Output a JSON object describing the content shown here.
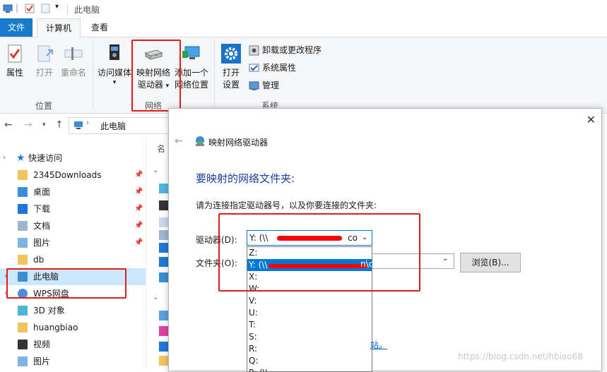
{
  "window": {
    "title": "此电脑"
  },
  "tabs": {
    "file": "文件",
    "computer": "计算机",
    "view": "查看"
  },
  "ribbon": {
    "location": {
      "properties": "属性",
      "open": "打开",
      "rename": "重命名",
      "group": "位置"
    },
    "network": {
      "media": "访问媒体",
      "map_drive_line1": "映射网络",
      "map_drive_line2": "驱动器",
      "add_location_line1": "添加一个",
      "add_location_line2": "网络位置",
      "group": "网络"
    },
    "system": {
      "open_settings_line1": "打开",
      "open_settings_line2": "设置",
      "uninstall": "卸载或更改程序",
      "system_properties": "系统属性",
      "manage": "管理",
      "group": "系统"
    }
  },
  "address": {
    "path": "此电脑"
  },
  "nav": {
    "quick_access": "快速访问",
    "items": [
      {
        "label": "2345Downloads",
        "pinned": true,
        "icon": "folder-icon"
      },
      {
        "label": "桌面",
        "pinned": true,
        "icon": "desktop-icon"
      },
      {
        "label": "下载",
        "pinned": true,
        "icon": "download-icon"
      },
      {
        "label": "文档",
        "pinned": true,
        "icon": "document-icon"
      },
      {
        "label": "图片",
        "pinned": true,
        "icon": "picture-icon"
      },
      {
        "label": "db",
        "pinned": false,
        "icon": "folder-check-icon"
      },
      {
        "label": "此电脑",
        "pinned": false,
        "icon": "computer-icon"
      },
      {
        "label": "WPS网盘",
        "pinned": false,
        "icon": "cloud-icon"
      },
      {
        "label": "3D 对象",
        "pinned": false,
        "icon": "cube-icon"
      },
      {
        "label": "huangbiao",
        "pinned": false,
        "icon": "folder-icon"
      },
      {
        "label": "视频",
        "pinned": false,
        "icon": "video-icon"
      },
      {
        "label": "图片",
        "pinned": false,
        "icon": "picture-icon"
      }
    ],
    "pin_glyph": "📌"
  },
  "content": {
    "col_header": "名"
  },
  "dialog": {
    "title": "映射网络驱动器",
    "heading": "要映射的网络文件夹:",
    "instruction": "请为连接指定驱动器号，以及你要连接的文件夹:",
    "drive_label": "驱动器(D):",
    "drive_value": "Y: (\\\\",
    "drive_value_tail": "co",
    "folder_label": "文件夹(O):",
    "browse": "浏览(B)...",
    "dropdown_options": [
      "Z:",
      "Y: (\\\\",
      "X:",
      "W:",
      "V:",
      "U:",
      "T:",
      "S:",
      "R:",
      "Q:",
      "P: (\\\\"
    ],
    "selected_option_tail": "n\\c",
    "link_fragment": "站。",
    "close_glyph": "✕"
  },
  "watermark": "https://blog.csdn.net/hbiao68",
  "colors": {
    "accent": "#1979ca",
    "annotation_red": "#e31b1b",
    "heading_blue": "#1e3ea0",
    "selection": "#0078d7"
  }
}
